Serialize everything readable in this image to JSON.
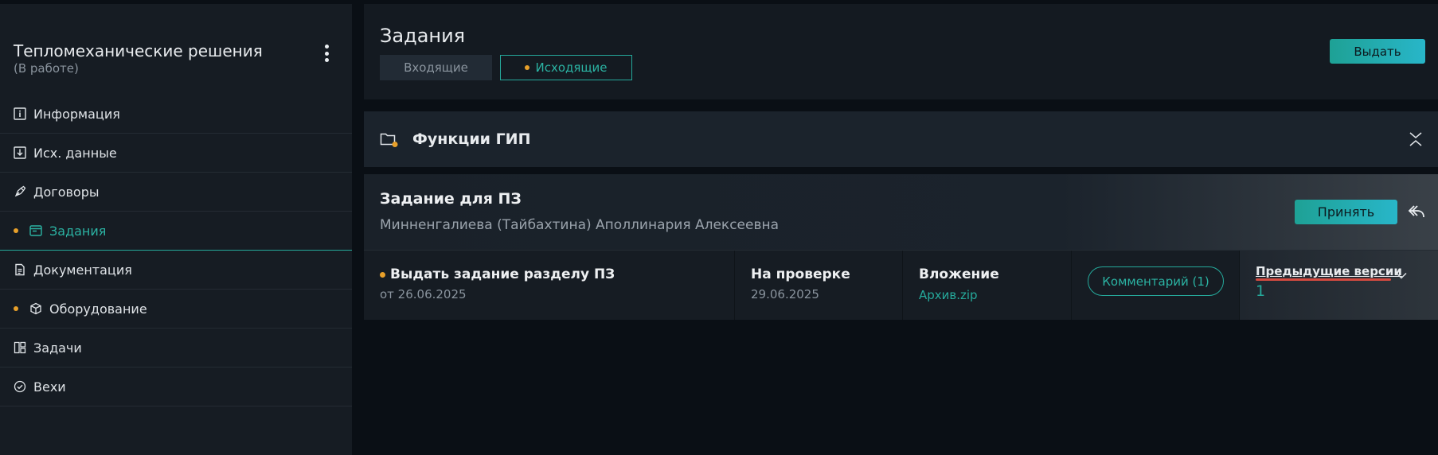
{
  "project": {
    "title": "Тепломеханические решения",
    "status": "(В работе)"
  },
  "sidebar": {
    "items": [
      {
        "label": "Информация",
        "icon": "info-icon",
        "dot": false
      },
      {
        "label": "Исх. данные",
        "icon": "download-box-icon",
        "dot": false
      },
      {
        "label": "Договоры",
        "icon": "pen-icon",
        "dot": false
      },
      {
        "label": "Задания",
        "icon": "window-icon",
        "dot": true,
        "active": true
      },
      {
        "label": "Документация",
        "icon": "document-icon",
        "dot": false
      },
      {
        "label": "Оборудование",
        "icon": "cube-icon",
        "dot": true
      },
      {
        "label": "Задачи",
        "icon": "board-icon",
        "dot": false
      },
      {
        "label": "Вехи",
        "icon": "check-circle-icon",
        "dot": false
      }
    ]
  },
  "tasks": {
    "title": "Задания",
    "tab_incoming": "Входящие",
    "tab_outgoing": "Исходящие",
    "issue_button": "Выдать"
  },
  "group": {
    "title": "Функции ГИП"
  },
  "card": {
    "title": "Задание для ПЗ",
    "person": "Минненгалиева (Тайбахтина) Аполлинария Алексеевна",
    "accept_button": "Принять",
    "task_name": "Выдать задание разделу ПЗ",
    "task_date": "от 26.06.2025",
    "status": "На проверке",
    "status_date": "29.06.2025",
    "attachment_label": "Вложение",
    "attachment_file": "Архив.zip",
    "comment_button": "Комментарий (1)",
    "prev_versions_label": "Предыдущие версии",
    "prev_versions_count": "1"
  },
  "colors": {
    "accent": "#25a99b",
    "dot": "#e8a02a",
    "highlight": "#d34a40"
  }
}
